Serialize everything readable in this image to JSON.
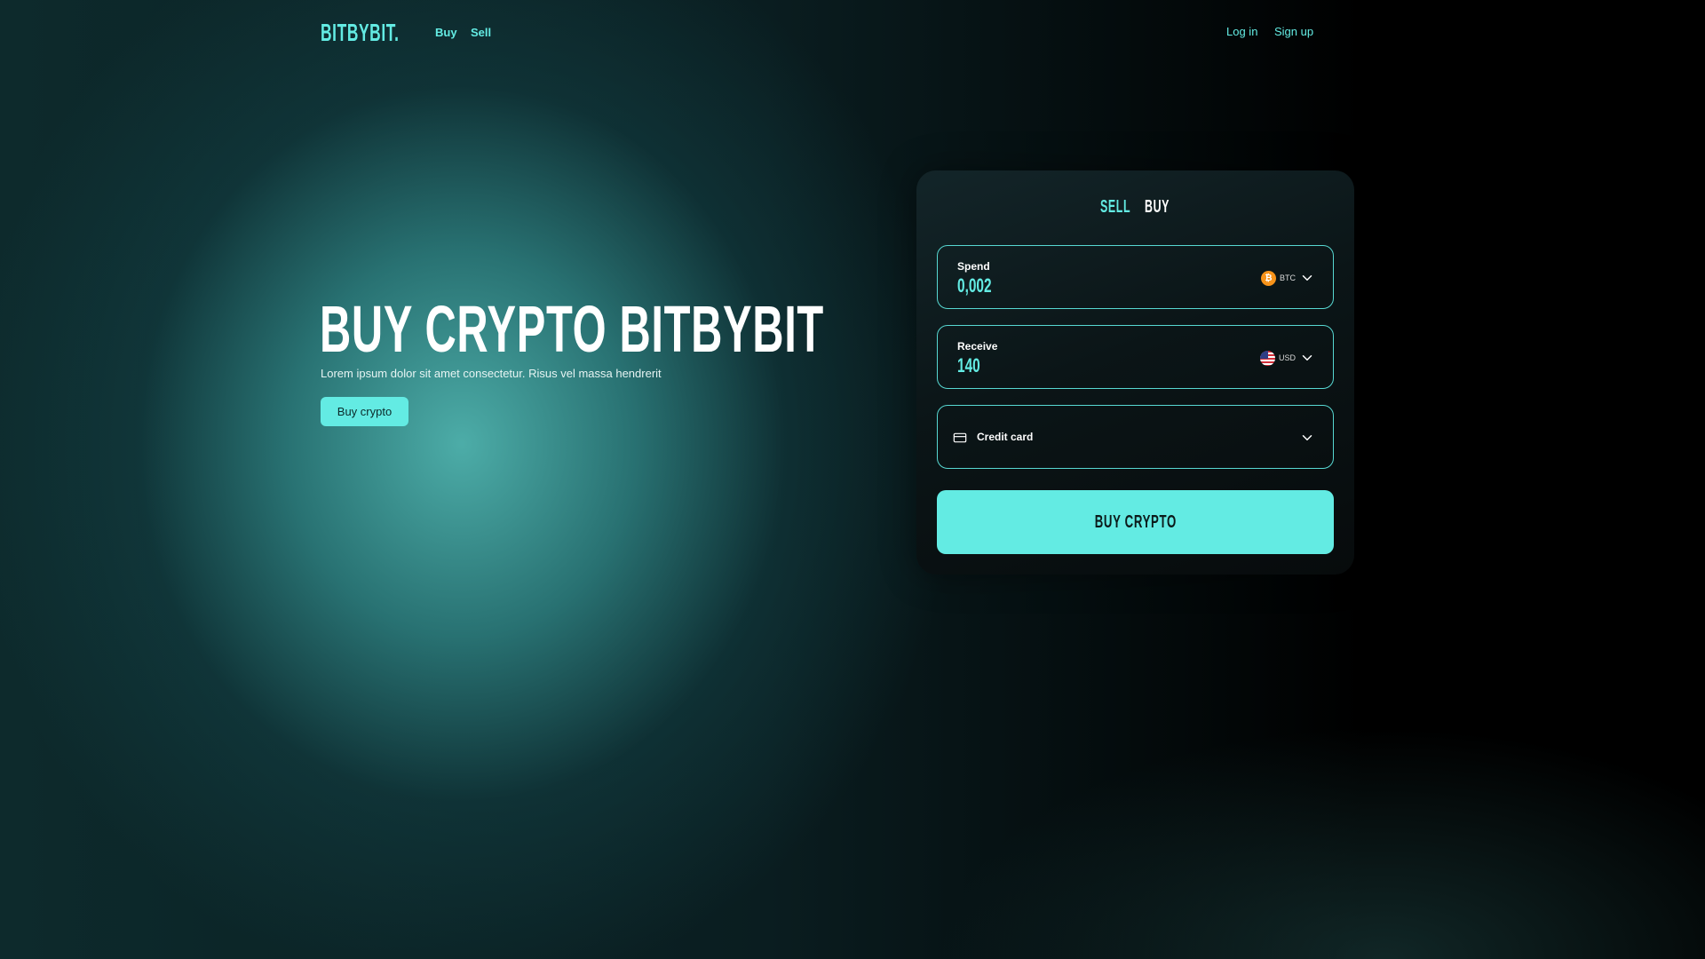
{
  "header": {
    "logo": "BITBYBIT.",
    "nav": [
      {
        "label": "Buy"
      },
      {
        "label": "Sell"
      }
    ],
    "login": "Log in",
    "signup": "Sign up"
  },
  "hero": {
    "title": "BUY CRYPTO BITBYBIT",
    "subtitle": "Lorem ipsum dolor sit amet consectetur. Risus vel massa hendrerit",
    "button": "Buy crypto"
  },
  "card": {
    "tabs": [
      {
        "label": "SELL",
        "active": true
      },
      {
        "label": "BUY",
        "active": false
      }
    ],
    "spend": {
      "label": "Spend",
      "value": "0,002",
      "currency": "BTC",
      "icon": "bitcoin-icon"
    },
    "receive": {
      "label": "Receive",
      "value": "140",
      "currency": "USD",
      "icon": "us-flag-icon"
    },
    "payment": {
      "label": "Credit card",
      "icon": "credit-card-icon"
    },
    "submit": "BUY CRYPTO"
  },
  "colors": {
    "accent": "#63ebe3",
    "text": "#ffffff",
    "bitcoin": "#f7931a"
  }
}
